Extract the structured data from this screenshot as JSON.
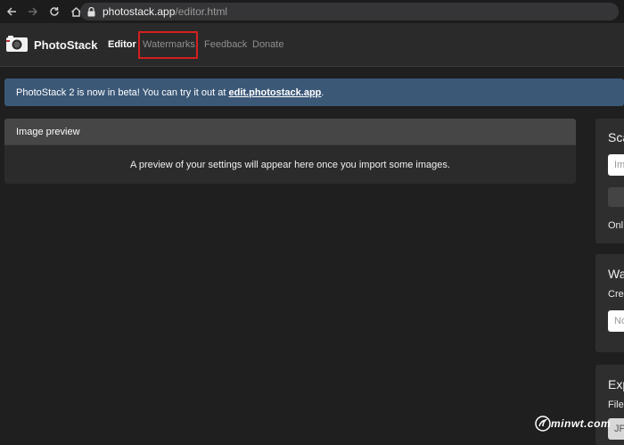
{
  "browser": {
    "url_host": "photostack.app",
    "url_path": "/editor.html"
  },
  "app": {
    "name": "PhotoStack",
    "nav": {
      "editor": "Editor",
      "watermarks": "Watermarks",
      "feedback": "Feedback",
      "donate": "Donate"
    }
  },
  "banner": {
    "text": "PhotoStack 2 is now in beta! You can try it out at ",
    "link": "edit.photostack.app",
    "end": "."
  },
  "preview": {
    "title": "Image preview",
    "message": "A preview of your settings will appear here once you import some images."
  },
  "side": {
    "scale_title": "Sca",
    "scale_input": "Im",
    "scale_note": "Onl",
    "watermark_title": "Wa",
    "watermark_text": "Crea",
    "watermark_select": "No",
    "export_title": "Exp",
    "export_file": "File",
    "export_select": "JP"
  },
  "watermark": {
    "text": "minwt.com"
  },
  "colors": {
    "accent_banner": "#3b5877",
    "highlight": "#d3201f"
  }
}
